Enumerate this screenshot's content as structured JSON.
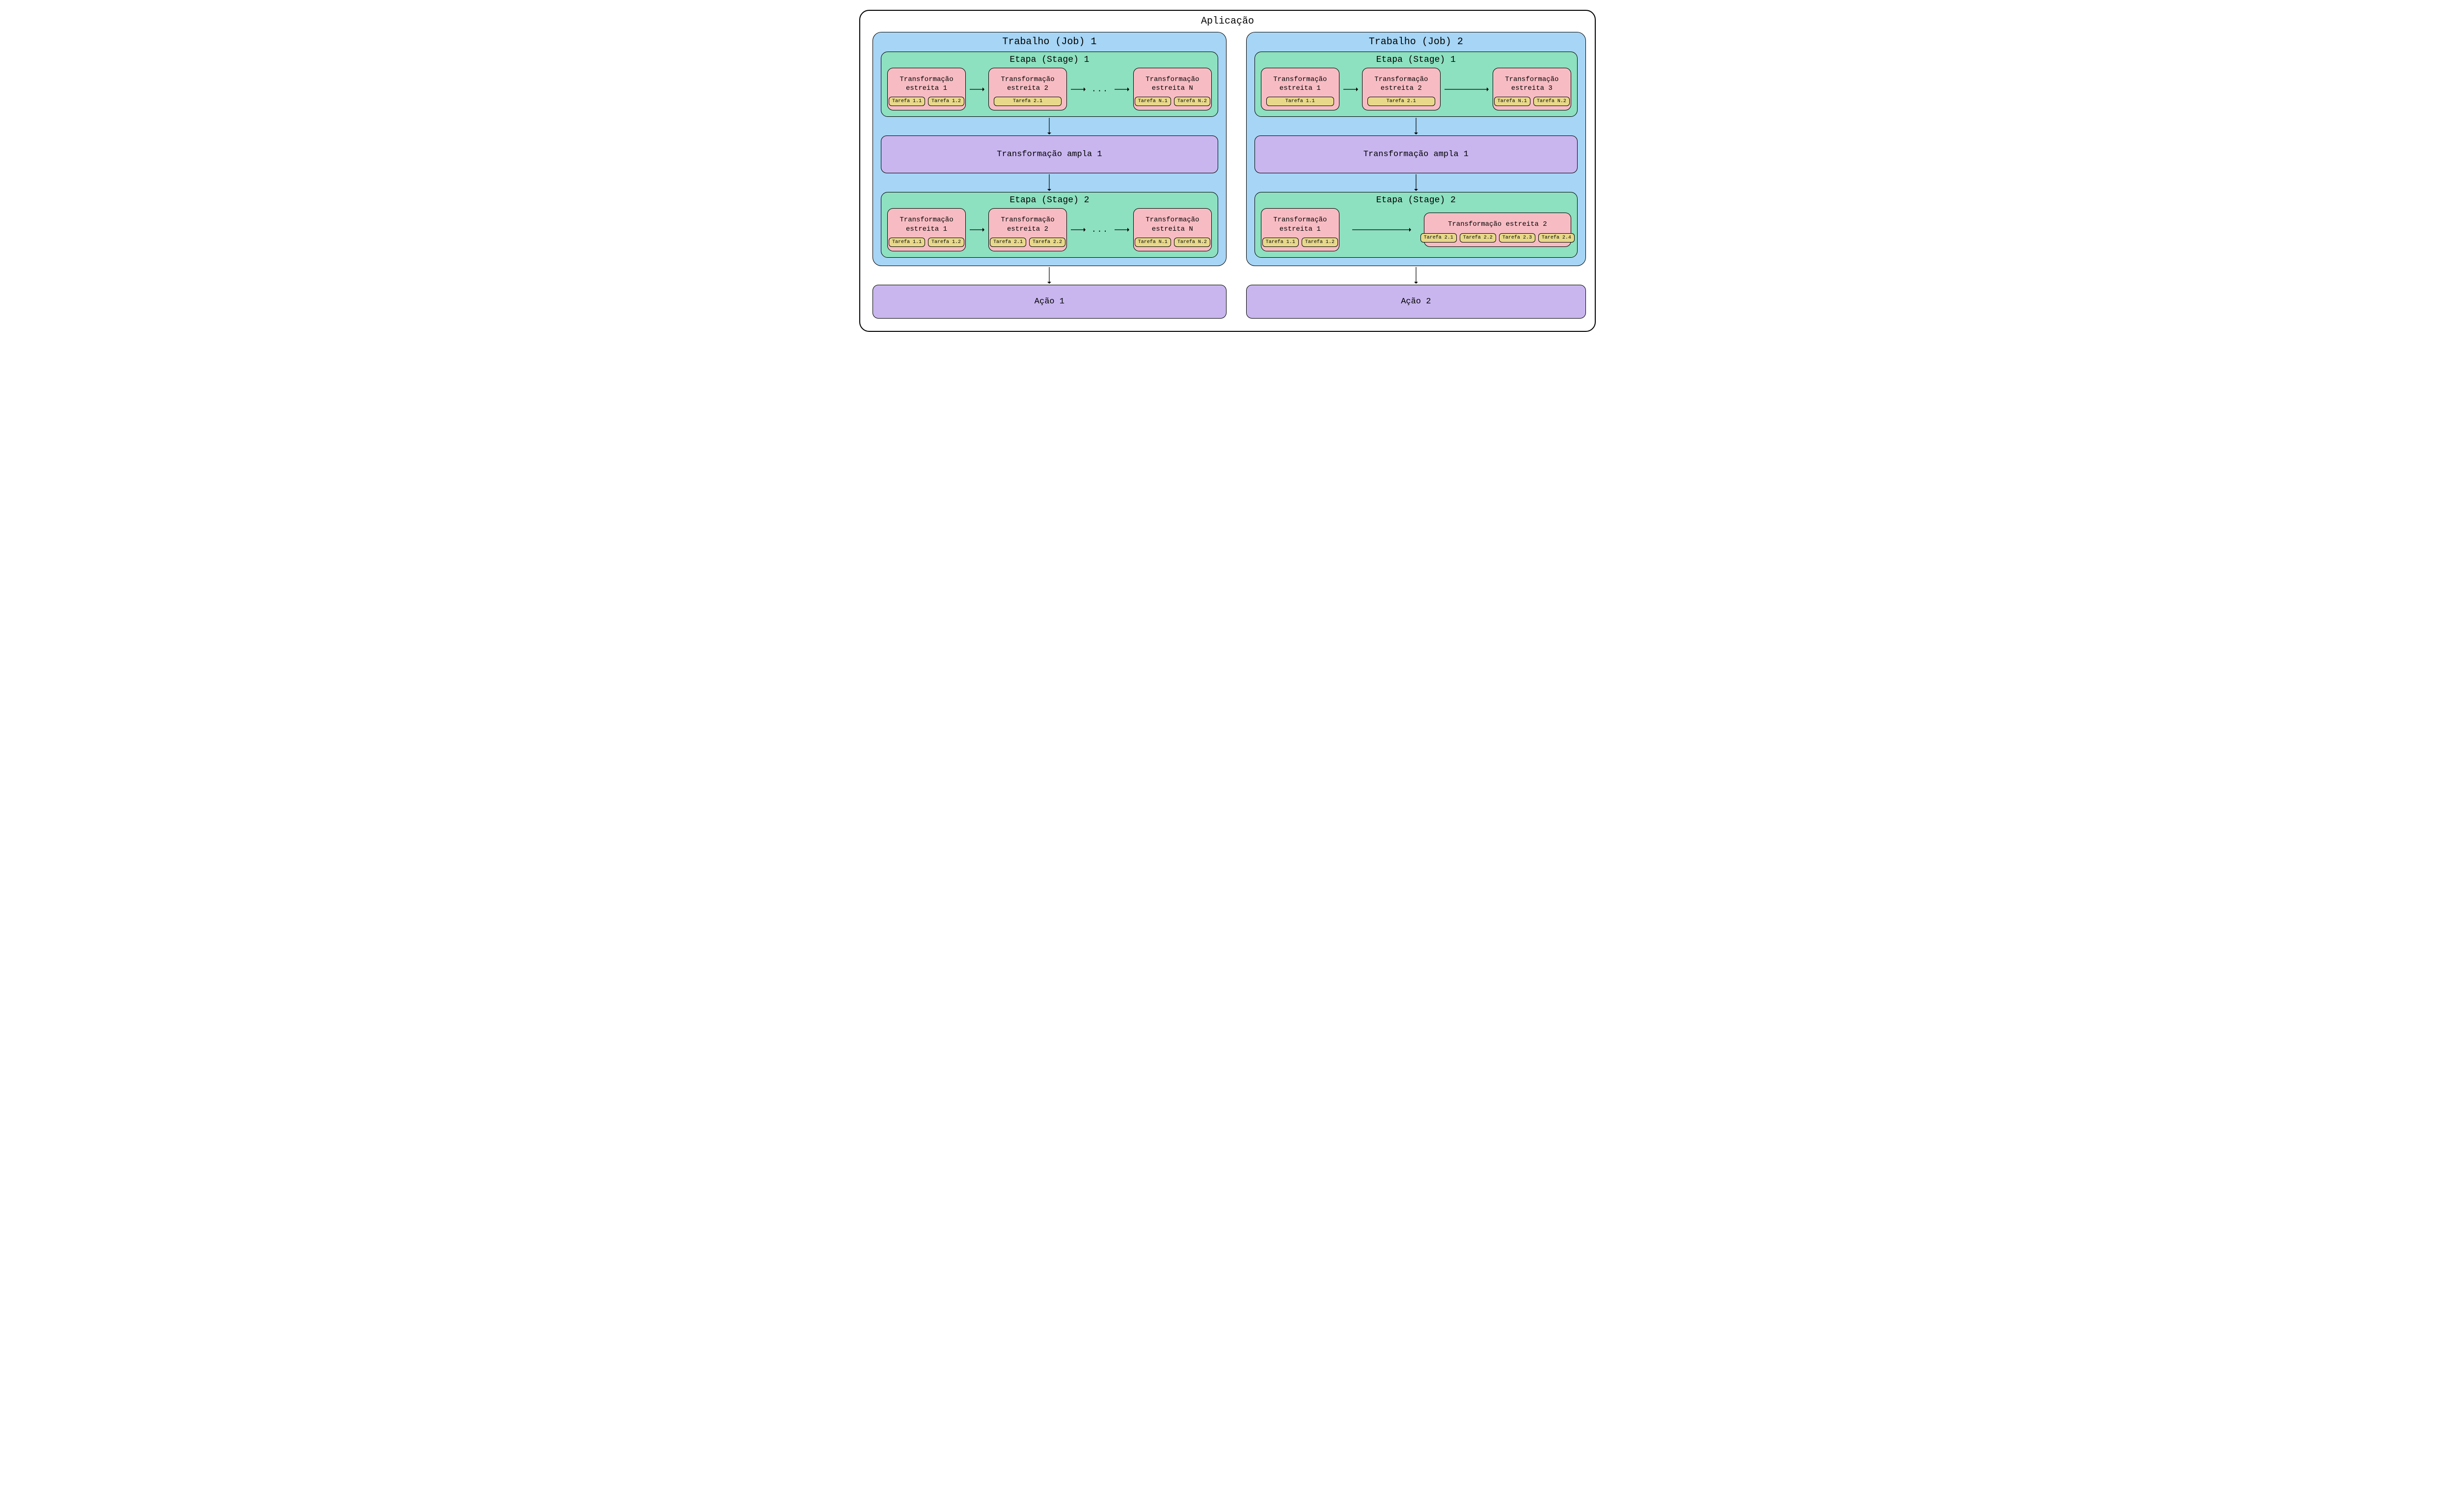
{
  "app_title": "Aplicação",
  "jobs": [
    {
      "title": "Trabalho (Job) 1",
      "stage1": {
        "title": "Etapa (Stage) 1",
        "t1": {
          "label": "Transformação\nestreita 1",
          "tasks": [
            "Tarefa 1.1",
            "Tarefa 1.2"
          ]
        },
        "t2": {
          "label": "Transformação\nestreita 2",
          "tasks": [
            "Tarefa 2.1"
          ]
        },
        "ellipsis": "...",
        "tN": {
          "label": "Transformação\nestreita N",
          "tasks": [
            "Tarefa N.1",
            "Tarefa N.2"
          ]
        }
      },
      "wide": "Transformação ampla 1",
      "stage2": {
        "title": "Etapa (Stage) 2",
        "t1": {
          "label": "Transformação\nestreita 1",
          "tasks": [
            "Tarefa 1.1",
            "Tarefa 1.2"
          ]
        },
        "t2": {
          "label": "Transformação\nestreita 2",
          "tasks": [
            "Tarefa 2.1",
            "Tarefa 2.2"
          ]
        },
        "ellipsis": "...",
        "tN": {
          "label": "Transformação\nestreita N",
          "tasks": [
            "Tarefa N.1",
            "Tarefa N.2"
          ]
        }
      },
      "action": "Ação 1"
    },
    {
      "title": "Trabalho (Job) 2",
      "stage1": {
        "title": "Etapa (Stage) 1",
        "t1": {
          "label": "Transformação\nestreita 1",
          "tasks": [
            "Tarefa 1.1"
          ]
        },
        "t2": {
          "label": "Transformação\nestreita 2",
          "tasks": [
            "Tarefa 2.1"
          ]
        },
        "t3": {
          "label": "Transformação\nestreita 3",
          "tasks": [
            "Tarefa N.1",
            "Tarefa N.2"
          ]
        }
      },
      "wide": "Transformação ampla 1",
      "stage2": {
        "title": "Etapa (Stage) 2",
        "t1": {
          "label": "Transformação\nestreita 1",
          "tasks": [
            "Tarefa 1.1",
            "Tarefa 1.2"
          ]
        },
        "t2": {
          "label": "Transformação estreita 2",
          "tasks": [
            "Tarefa 2.1",
            "Tarefa 2.2",
            "Tarefa 2.3",
            "Tarefa 2.4"
          ]
        }
      },
      "action": "Ação 2"
    }
  ]
}
